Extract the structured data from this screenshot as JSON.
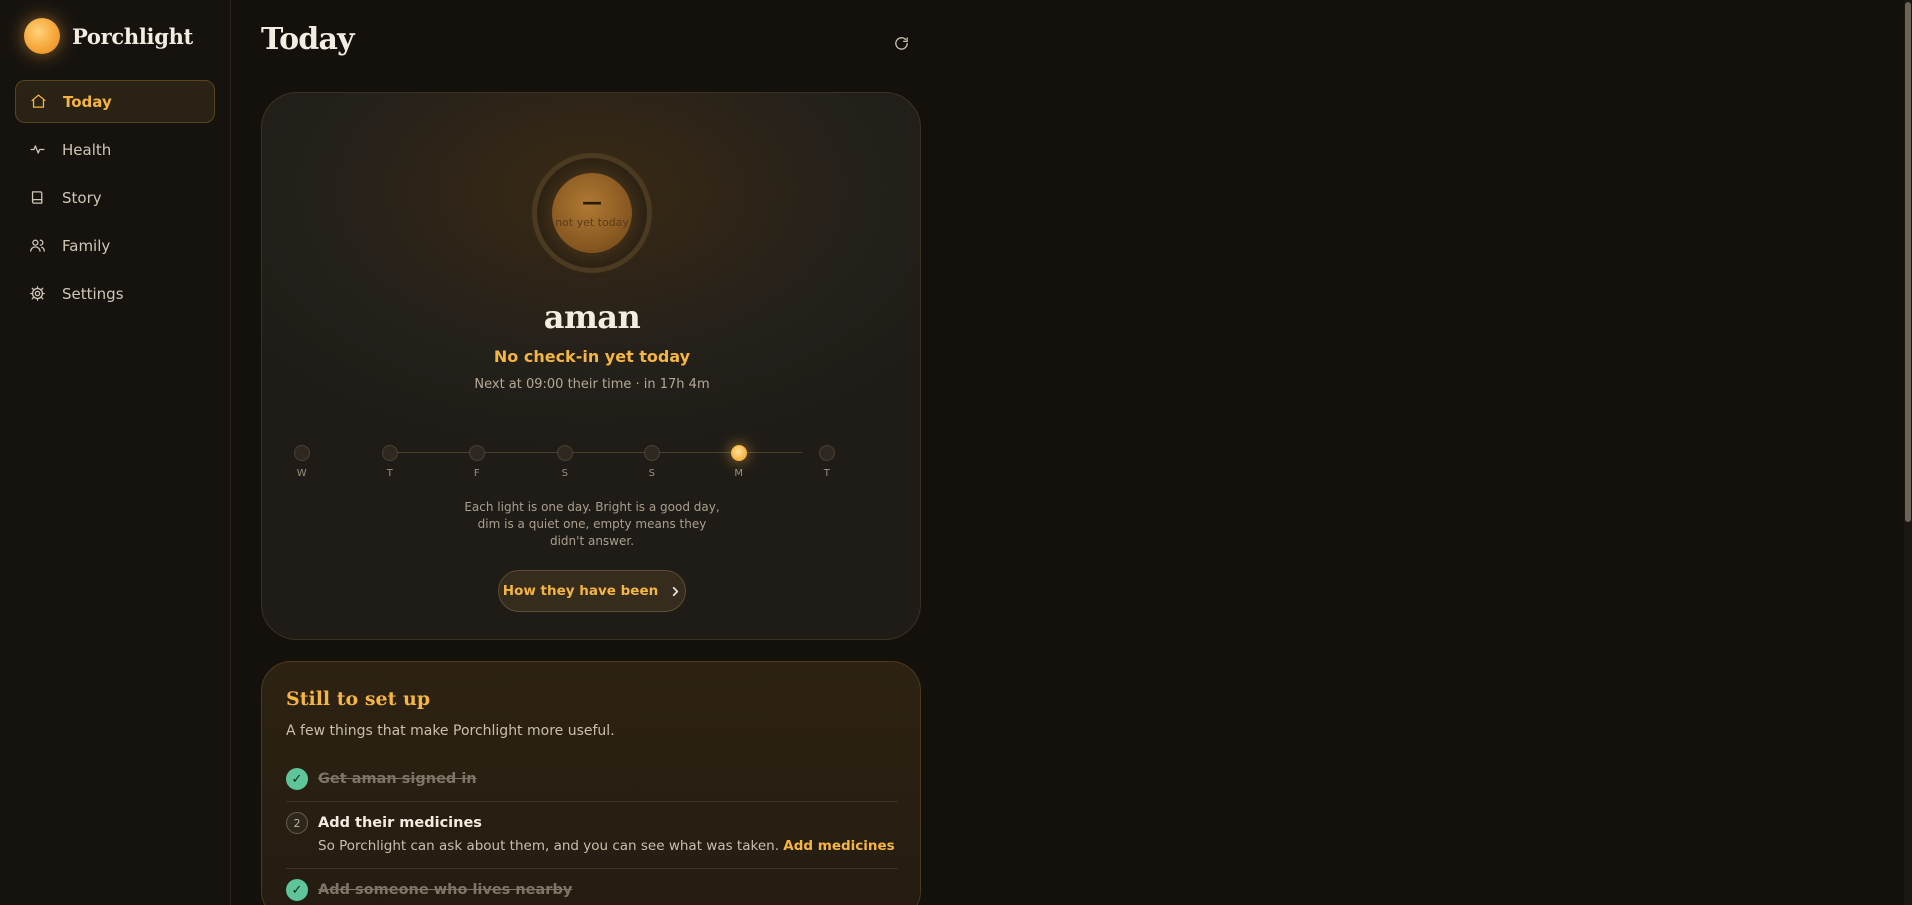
{
  "brand": {
    "name": "Porchlight"
  },
  "nav": [
    {
      "label": "Today",
      "icon": "home-icon",
      "active": true
    },
    {
      "label": "Health",
      "icon": "activity-icon",
      "active": false
    },
    {
      "label": "Story",
      "icon": "book-icon",
      "active": false
    },
    {
      "label": "Family",
      "icon": "users-icon",
      "active": false
    },
    {
      "label": "Settings",
      "icon": "gear-icon",
      "active": false
    }
  ],
  "header": {
    "title": "Today",
    "refresh_icon": "refresh-icon"
  },
  "checkin": {
    "orb_value": "—",
    "orb_caption": "not yet today",
    "person": "aman",
    "status": "No check-in yet today",
    "next": "Next at 09:00 their time · in 17h 4m",
    "days": [
      {
        "label": "W",
        "state": "empty"
      },
      {
        "label": "T",
        "state": "empty"
      },
      {
        "label": "F",
        "state": "empty"
      },
      {
        "label": "S",
        "state": "empty"
      },
      {
        "label": "S",
        "state": "empty"
      },
      {
        "label": "M",
        "state": "bright"
      },
      {
        "label": "T",
        "state": "empty"
      }
    ],
    "legend": "Each light is one day. Bright is a good day, dim is a quiet one, empty means they didn't answer.",
    "cta_label": "How they have been"
  },
  "setup": {
    "title": "Still to set up",
    "subtitle": "A few things that make Porchlight more useful.",
    "tasks": [
      {
        "done": true,
        "title": "Get aman signed in"
      },
      {
        "done": false,
        "number": "2",
        "title": "Add their medicines",
        "desc": "So Porchlight can ask about them, and you can see what was taken.",
        "link": "Add medicines"
      },
      {
        "done": true,
        "title": "Add someone who lives nearby"
      }
    ]
  },
  "colors": {
    "accent": "#f5b542",
    "success": "#5ec49a",
    "background": "#14110d"
  }
}
